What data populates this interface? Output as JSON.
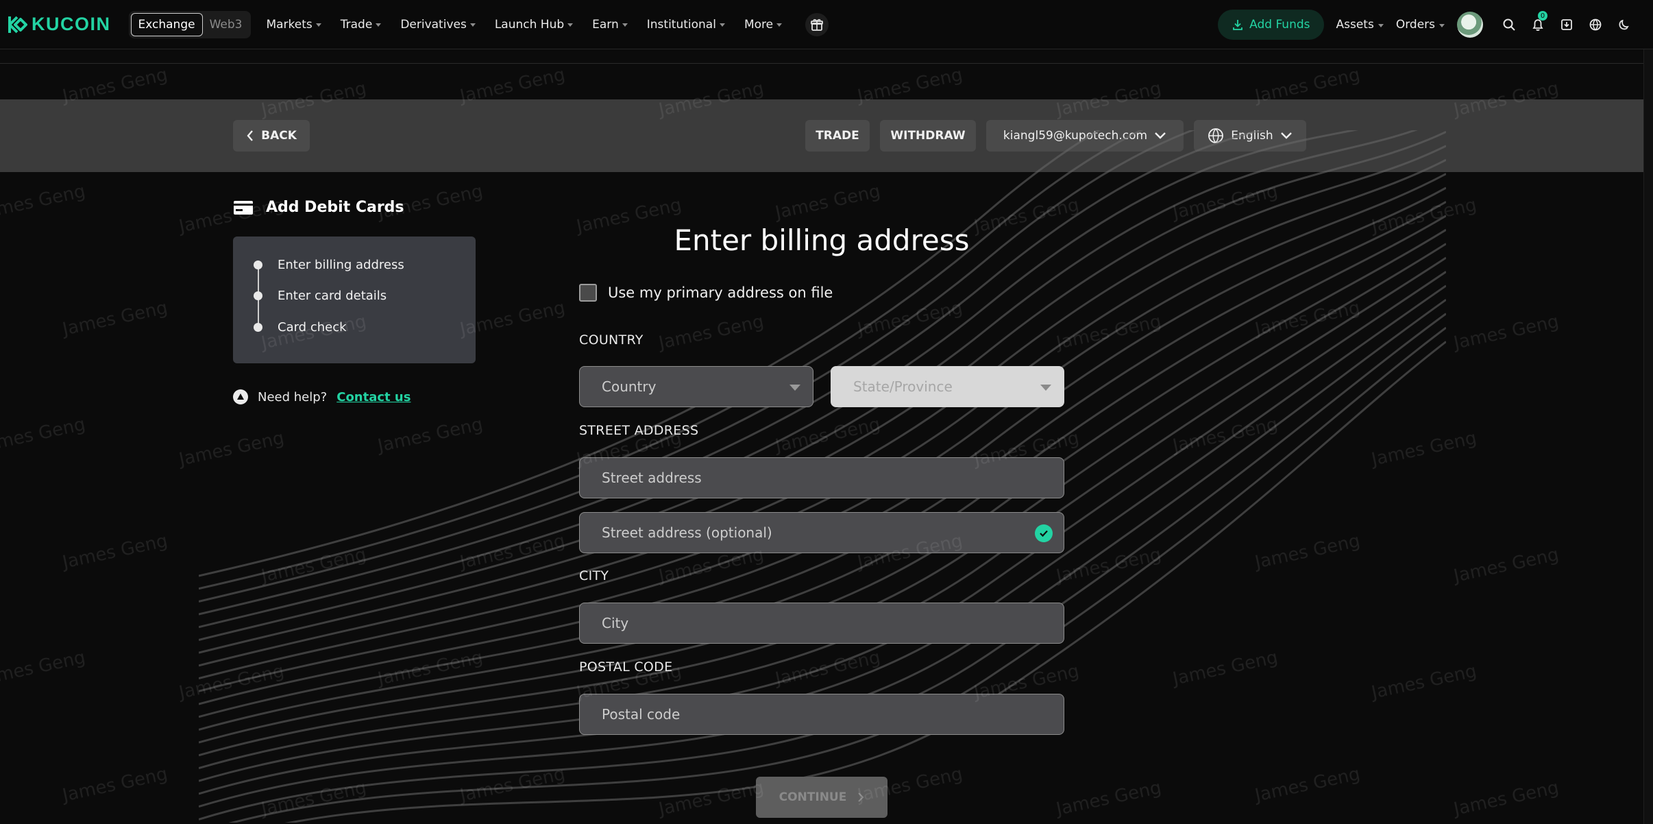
{
  "nav": {
    "brand": "KUCOIN",
    "segments": [
      "Exchange",
      "Web3"
    ],
    "menu": [
      "Markets",
      "Trade",
      "Derivatives",
      "Launch Hub",
      "Earn",
      "Institutional",
      "More"
    ],
    "add_funds": "Add Funds",
    "assets": "Assets",
    "orders": "Orders",
    "notification_count": "0"
  },
  "header": {
    "back": "BACK",
    "trade": "TRADE",
    "withdraw": "WITHDRAW",
    "email": "kiangl59@kupotech.com",
    "language": "English"
  },
  "sidebar": {
    "title": "Add Debit Cards",
    "steps": [
      "Enter billing address",
      "Enter card details",
      "Card check"
    ],
    "help_text": "Need help?",
    "help_link": "Contact us"
  },
  "form": {
    "title": "Enter billing address",
    "primary_checkbox": "Use my primary address on file",
    "country_label": "COUNTRY",
    "country_placeholder": "Country",
    "state_placeholder": "State/Province",
    "street_label": "STREET ADDRESS",
    "street_placeholder": "Street address",
    "street2_placeholder": "Street address (optional)",
    "city_label": "CITY",
    "city_placeholder": "City",
    "postal_label": "POSTAL CODE",
    "postal_placeholder": "Postal code",
    "continue": "CONTINUE"
  },
  "watermark": "James Geng",
  "colors": {
    "accent": "#23d3a3",
    "background": "#0b0b0b",
    "band": "#3b3b3b"
  }
}
